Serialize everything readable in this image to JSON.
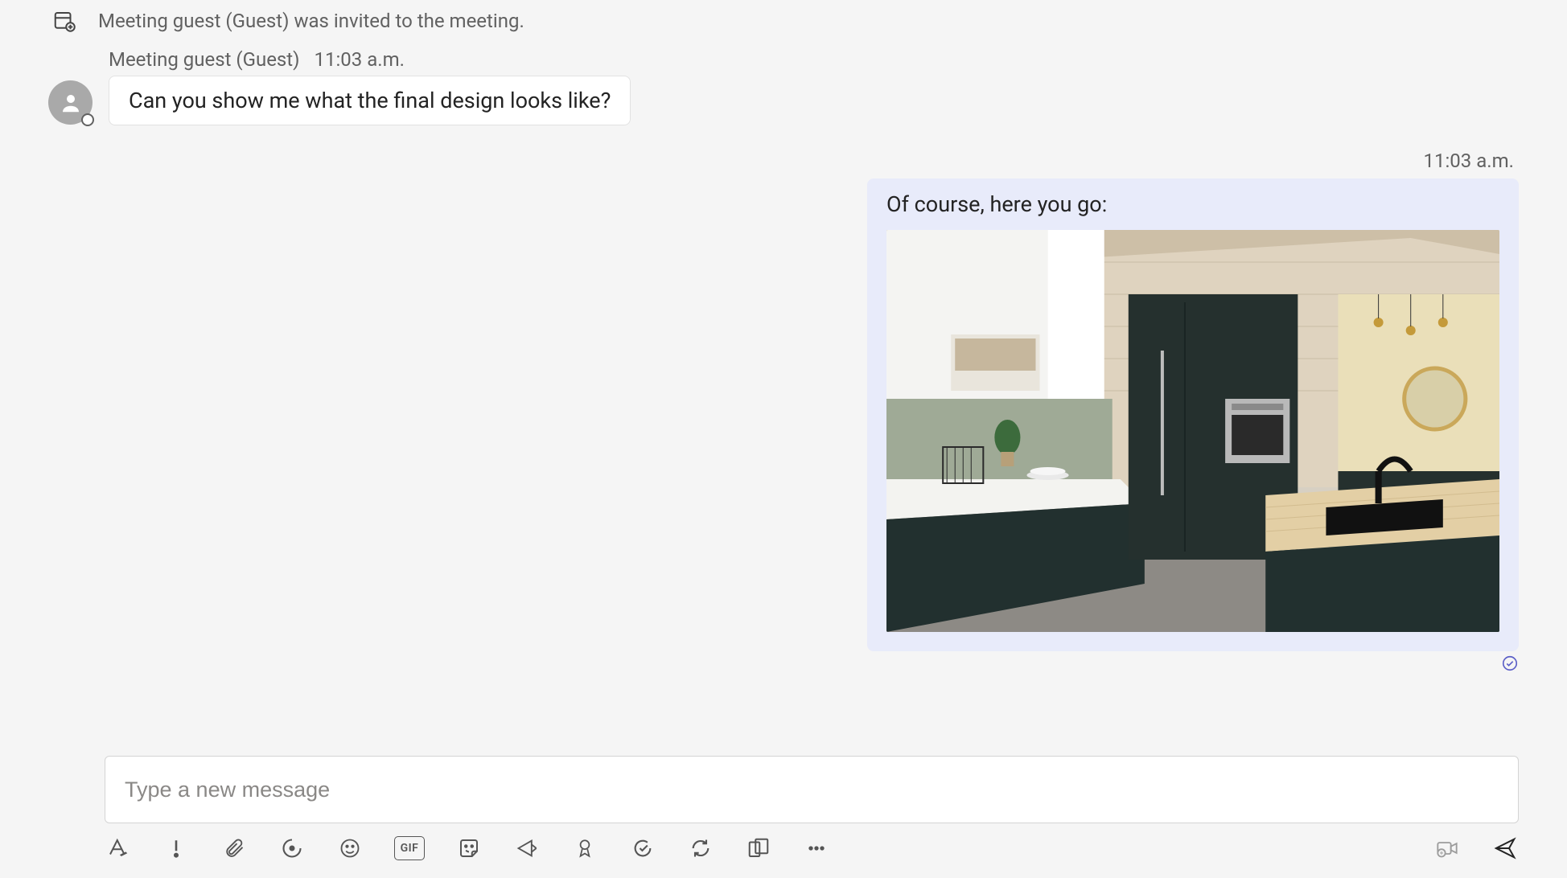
{
  "system_event": {
    "text": "Meeting guest (Guest) was invited to the meeting."
  },
  "incoming_message": {
    "author": "Meeting guest (Guest)",
    "time": "11:03 a.m.",
    "body": "Can you show me what the final design looks like?"
  },
  "outgoing_message": {
    "time": "11:03 a.m.",
    "body": "Of course, here you go:",
    "attachment": {
      "kind": "image",
      "description": "Photo of a modern kitchen with dark matte cabinets, light wood walls and countertop, built-in oven, island with black faucet and sink, round wall mirror."
    }
  },
  "compose": {
    "placeholder": "Type a new message"
  },
  "toolbar": {
    "format": "Format",
    "priority": "Set delivery options",
    "attach": "Attach files",
    "loop": "Loop components",
    "emoji": "Emoji",
    "gif_label": "GIF",
    "sticker": "Sticker",
    "actions": "Messaging extensions",
    "praise": "Praise",
    "approvals": "Approvals",
    "updates": "Viva",
    "apps": "Apps",
    "more": "More options",
    "video_clip": "Record a video clip",
    "send": "Send"
  },
  "icons": {
    "calendar_add": "calendar-add-icon",
    "person": "person-icon"
  }
}
